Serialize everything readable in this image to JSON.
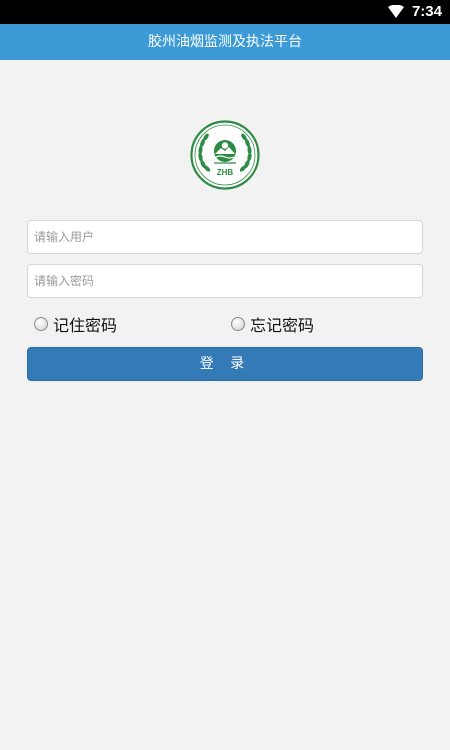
{
  "status_bar": {
    "time": "7:34",
    "wifi_icon": "wifi-icon"
  },
  "header": {
    "title": "胶州油烟监测及执法平台"
  },
  "logo": {
    "text": "ZHB",
    "color": "#2e8b45"
  },
  "form": {
    "username_placeholder": "请输入用户",
    "username_value": "",
    "password_placeholder": "请输入密码",
    "password_value": "",
    "remember_label": "记住密码",
    "remember_checked": false,
    "forget_label": "忘记密码",
    "login_label": "登 录"
  },
  "colors": {
    "header_bg": "#3c9bd6",
    "button_bg": "#337ab7",
    "page_bg": "#f2f2f2"
  }
}
